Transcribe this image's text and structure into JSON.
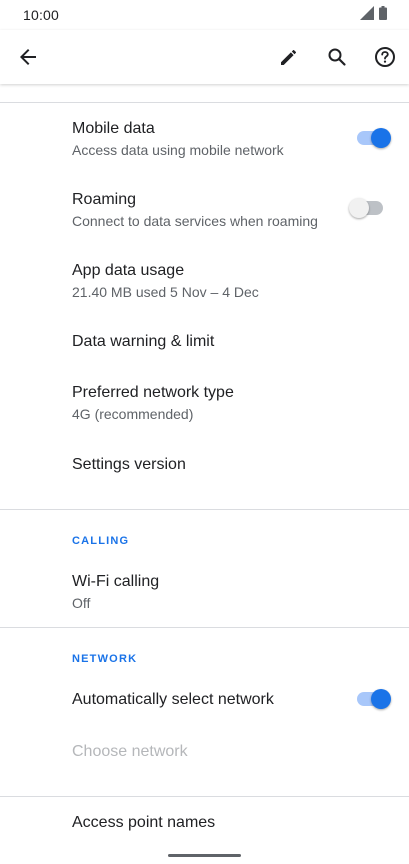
{
  "status_bar": {
    "time": "10:00",
    "icons": [
      "signal-icon",
      "battery-icon"
    ]
  },
  "app_bar": {
    "icons": [
      "back-arrow-icon",
      "edit-pencil-icon",
      "search-icon",
      "help-icon"
    ]
  },
  "items": {
    "mobile_data": {
      "title": "Mobile data",
      "subtitle": "Access data using mobile network",
      "toggle": "on"
    },
    "roaming": {
      "title": "Roaming",
      "subtitle": "Connect to data services when roaming",
      "toggle": "off"
    },
    "app_data_usage": {
      "title": "App data usage",
      "subtitle": "21.40 MB used 5 Nov – 4 Dec"
    },
    "data_warning": {
      "title": "Data warning & limit"
    },
    "preferred_network": {
      "title": "Preferred network type",
      "subtitle": "4G (recommended)"
    },
    "settings_version": {
      "title": "Settings version"
    }
  },
  "calling": {
    "header": "CALLING",
    "wifi_calling": {
      "title": "Wi-Fi calling",
      "subtitle": "Off"
    }
  },
  "network": {
    "header": "NETWORK",
    "auto_select": {
      "title": "Automatically select network",
      "toggle": "on"
    },
    "choose_network": {
      "title": "Choose network",
      "enabled": false
    }
  },
  "access_point_names": {
    "title": "Access point names"
  },
  "colors": {
    "accent": "#1a73e8",
    "toggle_on_track": "#a8c7fa",
    "divider": "#dadce0",
    "secondary_text": "#5f6368",
    "disabled_text": "#b5b7ba"
  }
}
